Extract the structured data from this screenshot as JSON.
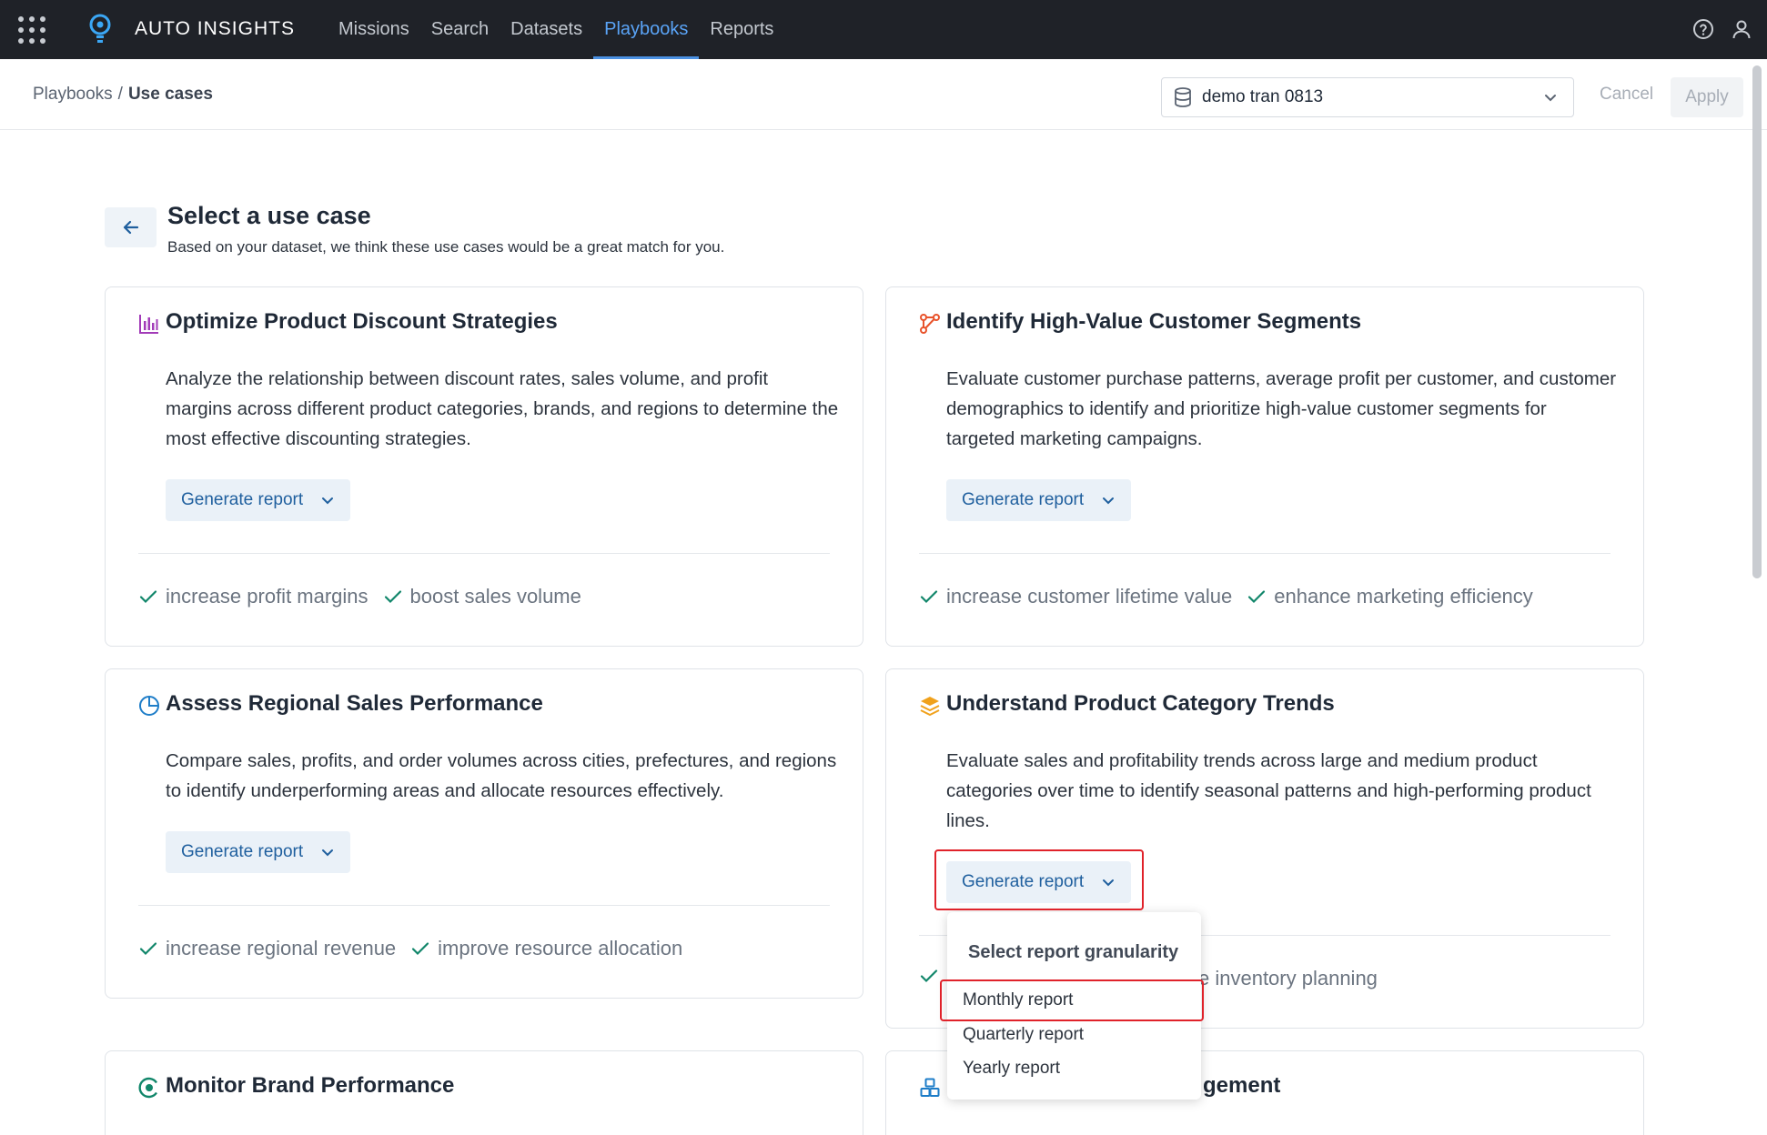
{
  "topbar": {
    "brand": "AUTO INSIGHTS",
    "nav": [
      "Missions",
      "Search",
      "Datasets",
      "Playbooks",
      "Reports"
    ],
    "active_nav": "Playbooks",
    "icons": [
      "apps-grid-icon",
      "lightbulb-logo-icon",
      "help-icon",
      "user-icon"
    ]
  },
  "breadcrumb": {
    "parent": "Playbooks",
    "separator": "/",
    "current": "Use cases"
  },
  "dataset_select": {
    "value": "demo tran 0813"
  },
  "actions": {
    "cancel": "Cancel",
    "apply": "Apply"
  },
  "page": {
    "title": "Select a use case",
    "subtitle": "Based on your dataset, we think these use cases would be a great match for you."
  },
  "cards": [
    {
      "title": "Optimize Product Discount Strategies",
      "icon": "bar-chart-icon",
      "icon_color": "#a23bb8",
      "description": "Analyze the relationship between discount rates, sales volume, and profit margins across different product categories, brands, and regions to determine the most effective discounting strategies.",
      "button": "Generate report",
      "benefits": [
        "increase profit margins",
        "boost sales volume"
      ]
    },
    {
      "title": "Identify High-Value Customer Segments",
      "icon": "segments-icon",
      "icon_color": "#e8532b",
      "description": "Evaluate customer purchase patterns, average profit per customer, and customer demographics to identify and prioritize high-value customer segments for targeted marketing campaigns.",
      "button": "Generate report",
      "benefits": [
        "increase customer lifetime value",
        "enhance marketing efficiency"
      ]
    },
    {
      "title": "Assess Regional Sales Performance",
      "icon": "pie-chart-icon",
      "icon_color": "#1e7dc8",
      "description": "Compare sales, profits, and order volumes across cities, prefectures, and regions to identify underperforming areas and allocate resources effectively.",
      "button": "Generate report",
      "benefits": [
        "increase regional revenue",
        "improve resource allocation"
      ]
    },
    {
      "title": "Understand Product Category Trends",
      "icon": "layers-icon",
      "icon_color": "#f0a11b",
      "description": "Evaluate sales and profitability trends across large and medium product categories over time to identify seasonal patterns and high-performing product lines.",
      "button": "Generate report",
      "benefits_visible": "e inventory planning"
    },
    {
      "title": "Monitor Brand Performance",
      "icon": "brand-icon",
      "icon_color": "#11866a"
    },
    {
      "title_visible": "gement",
      "icon": "boxes-icon",
      "icon_color": "#1e7dc8"
    }
  ],
  "dropdown": {
    "title": "Select report granularity",
    "options": [
      "Monthly report",
      "Quarterly report",
      "Yearly report"
    ],
    "highlighted": "Monthly report"
  },
  "colors": {
    "accent": "#4a90e2",
    "topbar_bg": "#1f2228",
    "check": "#11866a",
    "highlight": "#e0222a"
  }
}
